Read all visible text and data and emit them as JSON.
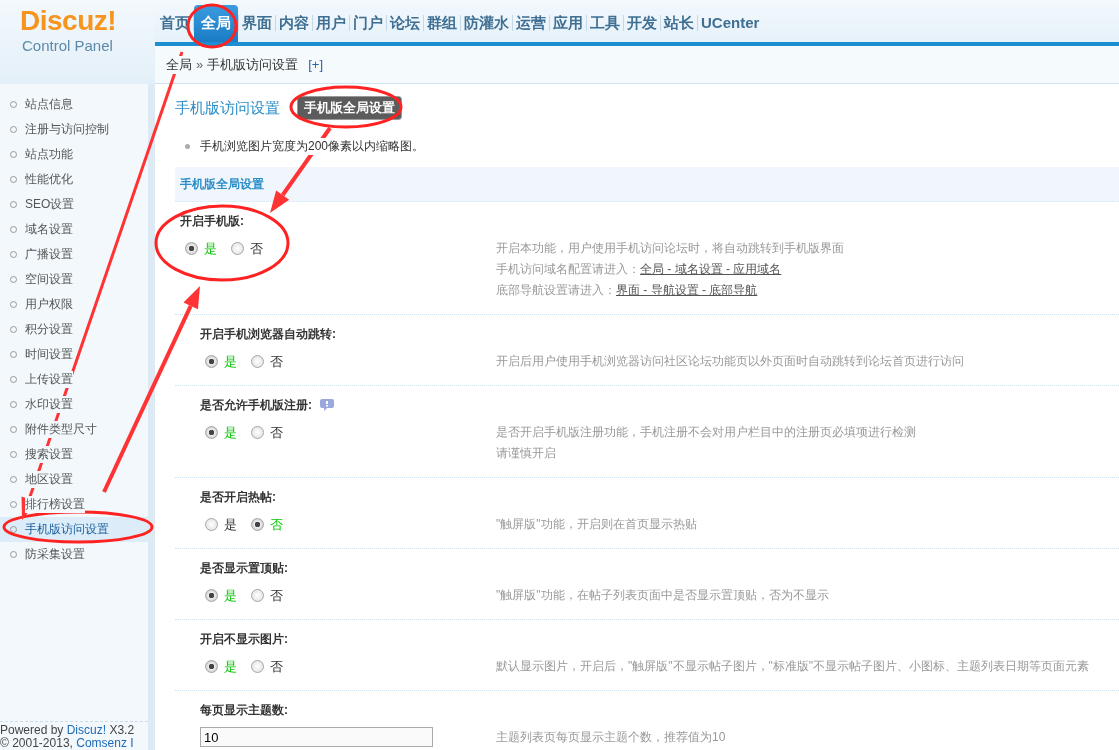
{
  "logo": {
    "brand": "Discuz!",
    "subtitle": "Control Panel"
  },
  "nav": [
    {
      "label": "首页",
      "selected": false
    },
    {
      "label": "全局",
      "selected": true
    },
    {
      "label": "界面",
      "selected": false
    },
    {
      "label": "内容",
      "selected": false
    },
    {
      "label": "用户",
      "selected": false
    },
    {
      "label": "门户",
      "selected": false
    },
    {
      "label": "论坛",
      "selected": false
    },
    {
      "label": "群组",
      "selected": false
    },
    {
      "label": "防灌水",
      "selected": false
    },
    {
      "label": "运营",
      "selected": false
    },
    {
      "label": "应用",
      "selected": false
    },
    {
      "label": "工具",
      "selected": false
    },
    {
      "label": "开发",
      "selected": false
    },
    {
      "label": "站长",
      "selected": false
    },
    {
      "label": "UCenter",
      "selected": false
    }
  ],
  "breadcrumb": {
    "items": [
      "全局",
      "手机版访问设置"
    ],
    "separator": "»",
    "add": "[+]"
  },
  "sidebar": {
    "items": [
      {
        "label": "站点信息",
        "selected": false
      },
      {
        "label": "注册与访问控制",
        "selected": false
      },
      {
        "label": "站点功能",
        "selected": false
      },
      {
        "label": "性能优化",
        "selected": false
      },
      {
        "label": "SEO设置",
        "selected": false
      },
      {
        "label": "域名设置",
        "selected": false
      },
      {
        "label": "广播设置",
        "selected": false
      },
      {
        "label": "空间设置",
        "selected": false
      },
      {
        "label": "用户权限",
        "selected": false
      },
      {
        "label": "积分设置",
        "selected": false
      },
      {
        "label": "时间设置",
        "selected": false
      },
      {
        "label": "上传设置",
        "selected": false
      },
      {
        "label": "水印设置",
        "selected": false
      },
      {
        "label": "附件类型尺寸",
        "selected": false
      },
      {
        "label": "搜索设置",
        "selected": false
      },
      {
        "label": "地区设置",
        "selected": false
      },
      {
        "label": "排行榜设置",
        "selected": false
      },
      {
        "label": "手机版访问设置",
        "selected": true
      },
      {
        "label": "防采集设置",
        "selected": false
      }
    ],
    "footer": [
      [
        {
          "text": "Powered by "
        },
        {
          "link": "Discuz!"
        },
        {
          "text": " X3.2"
        }
      ],
      [
        {
          "text": "© 2001-2013, "
        },
        {
          "link": "Comsenz I"
        }
      ]
    ]
  },
  "page_title": "手机版访问设置",
  "page_tabs": [
    {
      "label": "手机版全局设置",
      "selected": true
    }
  ],
  "tips": [
    "手机浏览图片宽度为200像素以内缩略图。"
  ],
  "section_title": "手机版全局设置",
  "settings": [
    {
      "label": "开启手机版:",
      "kind": "radio",
      "help": false,
      "options": [
        {
          "label": "是",
          "selected": true
        },
        {
          "label": "否",
          "selected": false
        }
      ],
      "description": [
        [
          {
            "text": "开启本功能，用户使用手机访问论坛时，将自动跳转到手机版界面"
          }
        ],
        [
          {
            "text": "手机访问域名配置请进入："
          },
          {
            "link": "全局 - 域名设置 - 应用域名"
          }
        ],
        [
          {
            "text": "底部导航设置请进入："
          },
          {
            "link": "界面 - 导航设置 - 底部导航"
          }
        ]
      ]
    },
    {
      "label": "开启手机浏览器自动跳转:",
      "kind": "radio",
      "help": false,
      "options": [
        {
          "label": "是",
          "selected": true
        },
        {
          "label": "否",
          "selected": false
        }
      ],
      "description": [
        [
          {
            "text": "开启后用户使用手机浏览器访问社区论坛功能页以外页面时自动跳转到论坛首页进行访问"
          }
        ]
      ]
    },
    {
      "label": "是否允许手机版注册:",
      "kind": "radio",
      "help": true,
      "options": [
        {
          "label": "是",
          "selected": true
        },
        {
          "label": "否",
          "selected": false
        }
      ],
      "description": [
        [
          {
            "text": "是否开启手机版注册功能，手机注册不会对用户栏目中的注册页必填项进行检测"
          }
        ],
        [
          {
            "text": "请谨慎开启"
          }
        ]
      ]
    },
    {
      "label": "是否开启热帖:",
      "kind": "radio",
      "help": false,
      "options": [
        {
          "label": "是",
          "selected": false
        },
        {
          "label": "否",
          "selected": true
        }
      ],
      "description": [
        [
          {
            "text": "\"触屏版\"功能，开启则在首页显示热贴"
          }
        ]
      ]
    },
    {
      "label": "是否显示置顶贴:",
      "kind": "radio",
      "help": false,
      "options": [
        {
          "label": "是",
          "selected": true
        },
        {
          "label": "否",
          "selected": false
        }
      ],
      "description": [
        [
          {
            "text": "\"触屏版\"功能，在帖子列表页面中是否显示置顶贴，否为不显示"
          }
        ]
      ]
    },
    {
      "label": "开启不显示图片:",
      "kind": "radio",
      "help": false,
      "options": [
        {
          "label": "是",
          "selected": true
        },
        {
          "label": "否",
          "selected": false
        }
      ],
      "description": [
        [
          {
            "text": "默认显示图片，开启后，\"触屏版\"不显示帖子图片，\"标准版\"不显示帖子图片、小图标、主题列表日期等页面元素"
          }
        ]
      ]
    },
    {
      "label": "每页显示主题数:",
      "kind": "text",
      "help": false,
      "value": "10",
      "description": [
        [
          {
            "text": "主题列表页每页显示主题个数，推荐值为10"
          }
        ]
      ]
    }
  ]
}
